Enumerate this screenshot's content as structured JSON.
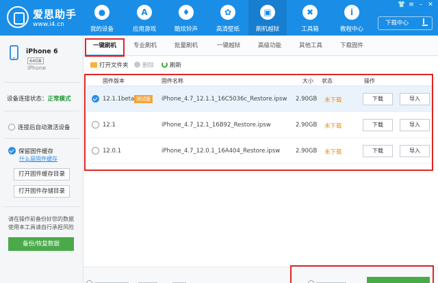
{
  "header": {
    "brand_name": "爱思助手",
    "brand_url": "www.i4.cn",
    "nav": [
      {
        "label": "我的设备",
        "icon": "apple-icon"
      },
      {
        "label": "应用游戏",
        "icon": "app-store-icon"
      },
      {
        "label": "酷炫铃声",
        "icon": "bell-icon"
      },
      {
        "label": "高清壁纸",
        "icon": "gear-flower-icon"
      },
      {
        "label": "刷机越狱",
        "icon": "box-icon"
      },
      {
        "label": "工具箱",
        "icon": "tools-icon"
      },
      {
        "label": "教程中心",
        "icon": "info-icon"
      }
    ],
    "active_nav": "刷机越狱",
    "download_center": "下载中心"
  },
  "sidebar": {
    "device_name": "iPhone 6",
    "capacity": "64GB",
    "model": "iPhone",
    "connection_label": "设备连接状态：",
    "connection_status": "正常模式",
    "auto_activate": "连接后自动激活设备",
    "keep_firmware": "保留固件缓存",
    "what_is_cache": "什么是固件缓存",
    "open_cache_dir": "打开固件缓存目录",
    "open_storage_dir": "打开固件存储目录",
    "note_line1": "请在操作前备份好您的数据",
    "note_line2": "使用本工具请自行承担风险",
    "backup_button": "备份/恢复数据"
  },
  "tabs": [
    "一键刷机",
    "专业刷机",
    "批量刷机",
    "一键越狱",
    "高级功能",
    "其他工具",
    "下载固件"
  ],
  "toolbar": {
    "open_folder": "打开文件夹",
    "delete": "删除",
    "refresh": "刷新"
  },
  "table": {
    "headers": {
      "version": "固件版本",
      "name": "固件名称",
      "size": "大小",
      "status": "状态",
      "actions": "操作"
    },
    "rows": [
      {
        "version": "12.1.1beta",
        "badge": "测试版",
        "name": "iPhone_4.7_12.1.1_16C5036c_Restore.ipsw",
        "size": "2.90GB",
        "status": "未下载",
        "download": "下载",
        "import": "导入",
        "selected": true
      },
      {
        "version": "12.1",
        "badge": "",
        "name": "iPhone_4.7_12.1_16B92_Restore.ipsw",
        "size": "2.90GB",
        "status": "未下载",
        "download": "下载",
        "import": "导入",
        "selected": false
      },
      {
        "version": "12.0.1",
        "badge": "",
        "name": "iPhone_4.7_12.0.1_16A404_Restore.ipsw",
        "size": "2.90GB",
        "status": "未下载",
        "download": "下载",
        "import": "导入",
        "selected": false
      }
    ]
  },
  "colors": {
    "header": "#1a8ee6",
    "highlight": "#e02424",
    "status": "#f08c00",
    "connected": "#1e9a33",
    "button_green": "#4aaa4a"
  }
}
